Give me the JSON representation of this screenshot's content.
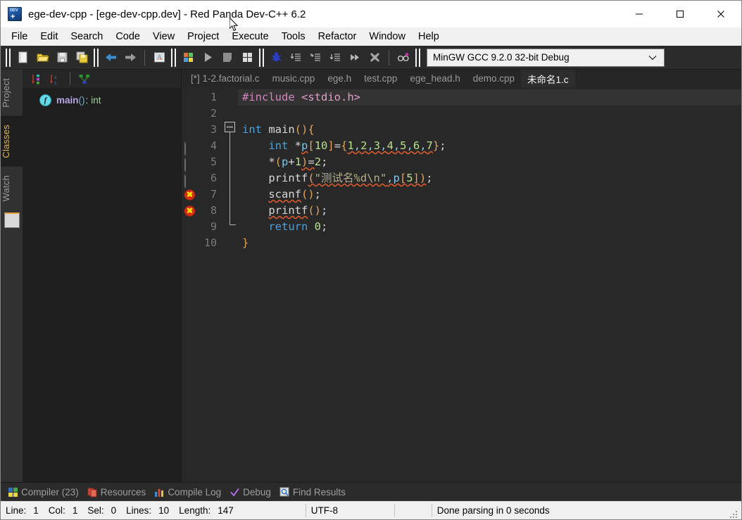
{
  "window": {
    "title": "ege-dev-cpp - [ege-dev-cpp.dev] - Red Panda Dev-C++ 6.2",
    "app_icon": "dev-cpp-icon",
    "minimize_label": "—",
    "maximize_label": "□",
    "close_label": "✕"
  },
  "menu": {
    "items": [
      {
        "label": "File"
      },
      {
        "label": "Edit"
      },
      {
        "label": "Search"
      },
      {
        "label": "Code"
      },
      {
        "label": "View"
      },
      {
        "label": "Project"
      },
      {
        "label": "Execute"
      },
      {
        "label": "Tools"
      },
      {
        "label": "Refactor"
      },
      {
        "label": "Window"
      },
      {
        "label": "Help"
      }
    ]
  },
  "toolbar": {
    "groups": [
      {
        "buttons": [
          {
            "name": "new-file-icon",
            "tip": "New"
          },
          {
            "name": "open-folder-icon",
            "tip": "Open"
          },
          {
            "name": "save-icon",
            "tip": "Save"
          },
          {
            "name": "save-all-icon",
            "tip": "Save All"
          }
        ]
      },
      {
        "buttons": [
          {
            "name": "back-arrow-icon",
            "tip": "Back"
          },
          {
            "name": "forward-arrow-icon",
            "tip": "Forward"
          },
          {
            "name": "format-code-icon",
            "tip": "Reformat Code"
          }
        ]
      },
      {
        "buttons": [
          {
            "name": "compile-icon",
            "tip": "Compile"
          },
          {
            "name": "run-icon",
            "tip": "Run"
          },
          {
            "name": "stop-execution-icon",
            "tip": "Stop Execution"
          },
          {
            "name": "compile-run-icon",
            "tip": "Compile & Run"
          }
        ]
      },
      {
        "buttons": [
          {
            "name": "debug-bug-icon",
            "tip": "Debug"
          },
          {
            "name": "step-over-icon",
            "tip": "Step Over"
          },
          {
            "name": "step-into-icon",
            "tip": "Step Into"
          },
          {
            "name": "step-out-icon",
            "tip": "Step Out"
          },
          {
            "name": "continue-icon",
            "tip": "Continue"
          },
          {
            "name": "stop-debug-icon",
            "tip": "Stop Debugger"
          }
        ]
      },
      {
        "buttons": [
          {
            "name": "add-watch-icon",
            "tip": "Add Watch"
          }
        ]
      }
    ],
    "compiler_set": {
      "value": "MinGW GCC 9.2.0 32-bit Debug",
      "caret": "⌄"
    }
  },
  "left_panel": {
    "vertical_tabs": [
      {
        "label": "Project",
        "active": false
      },
      {
        "label": "Classes",
        "active": true
      },
      {
        "label": "Watch",
        "active": false
      }
    ],
    "panel_toolbar": [
      {
        "name": "sort-by-type-icon"
      },
      {
        "name": "sort-alphabetical-icon"
      },
      {
        "name": "show-inherited-icon"
      }
    ],
    "class_browser": {
      "items": [
        {
          "icon": "function-icon",
          "name": "main",
          "parens": "()",
          "colon": ":",
          "return_type": "int"
        }
      ]
    }
  },
  "editor": {
    "tabs": [
      {
        "label": "[*] 1-2.factorial.c",
        "active": false
      },
      {
        "label": "music.cpp",
        "active": false
      },
      {
        "label": "ege.h",
        "active": false
      },
      {
        "label": "test.cpp",
        "active": false
      },
      {
        "label": "ege_head.h",
        "active": false
      },
      {
        "label": "demo.cpp",
        "active": false
      },
      {
        "label": "未命名1.c",
        "active": true
      }
    ],
    "gutter": [
      {
        "number": "1",
        "marker": "none"
      },
      {
        "number": "2",
        "marker": "none"
      },
      {
        "number": "3",
        "marker": "none"
      },
      {
        "number": "4",
        "marker": "breakpoint-gray"
      },
      {
        "number": "5",
        "marker": "breakpoint-gray"
      },
      {
        "number": "6",
        "marker": "breakpoint-gray"
      },
      {
        "number": "7",
        "marker": "error-red"
      },
      {
        "number": "8",
        "marker": "error-red"
      },
      {
        "number": "9",
        "marker": "none"
      },
      {
        "number": "10",
        "marker": "none"
      }
    ],
    "error_marker_glyph": "✖",
    "lines": [
      {
        "n": 1,
        "current": true,
        "text": "#include <stdio.h>"
      },
      {
        "n": 2,
        "current": false,
        "text": ""
      },
      {
        "n": 3,
        "current": false,
        "text": "int main(){"
      },
      {
        "n": 4,
        "current": false,
        "text": "    int *p[10]={1,2,3,4,5,6,7};"
      },
      {
        "n": 5,
        "current": false,
        "text": "    *(p+1)=2;"
      },
      {
        "n": 6,
        "current": false,
        "text": "    printf(\"测试名%d\\n\",p[5]);"
      },
      {
        "n": 7,
        "current": false,
        "text": "    scanf();"
      },
      {
        "n": 8,
        "current": false,
        "text": "    printf();"
      },
      {
        "n": 9,
        "current": false,
        "text": "    return 0;"
      },
      {
        "n": 10,
        "current": false,
        "text": "}"
      }
    ],
    "tokens": {
      "l1_include": "#include",
      "l1_header": "<stdio.h>",
      "l3_int": "int",
      "l3_main": "main",
      "l3_parens": "()",
      "l3_brace": "{",
      "l4_int": "int",
      "l4_star": "*",
      "l4_p": "p",
      "l4_lb": "[",
      "l4_10": "10",
      "l4_rb": "]",
      "l4_eq": "=",
      "l4_lbrace": "{",
      "l4_n1": "1",
      "l4_c1": ",",
      "l4_n2": "2",
      "l4_c2": ",",
      "l4_n3": "3",
      "l4_c3": ",",
      "l4_n4": "4",
      "l4_c4": ",",
      "l4_n5": "5",
      "l4_c5": ",",
      "l4_n6": "6",
      "l4_c6": ",",
      "l4_n7": "7",
      "l4_rbrace": "}",
      "l4_semi": ";",
      "l5_star": "*",
      "l5_lp": "(",
      "l5_p": "p",
      "l5_plus": "+",
      "l5_1": "1",
      "l5_rp": ")",
      "l5_eq": "=",
      "l5_2": "2",
      "l5_semi": ";",
      "l6_printf": "printf",
      "l6_lp": "(",
      "l6_str": "\"测试名%d\\n\"",
      "l6_comma": ",",
      "l6_p": "p",
      "l6_lb": "[",
      "l6_5": "5",
      "l6_rb": "]",
      "l6_rp": ")",
      "l6_semi": ";",
      "l7_scanf": "scanf",
      "l7_parens": "()",
      "l7_semi": ";",
      "l8_printf": "printf",
      "l8_parens": "()",
      "l8_semi": ";",
      "l9_return": "return",
      "l9_0": "0",
      "l9_semi": ";",
      "l10_rbrace": "}"
    }
  },
  "bottom_tabs": [
    {
      "label": "Compiler (23)",
      "icon": "compiler-icon"
    },
    {
      "label": "Resources",
      "icon": "resources-icon"
    },
    {
      "label": "Compile Log",
      "icon": "compile-log-icon"
    },
    {
      "label": "Debug",
      "icon": "debug-check-icon"
    },
    {
      "label": "Find Results",
      "icon": "find-results-icon"
    }
  ],
  "statusbar": {
    "line_label": "Line:",
    "line_value": "1",
    "col_label": "Col:",
    "col_value": "1",
    "sel_label": "Sel:",
    "sel_value": "0",
    "lines_label": "Lines:",
    "lines_value": "10",
    "length_label": "Length:",
    "length_value": "147",
    "encoding": "UTF-8",
    "message": "Done parsing in 0 seconds"
  },
  "colors": {
    "titlebar_bg": "#ffffff",
    "menubar_bg": "#f0f0f0",
    "toolbar_bg": "#2b2b2b",
    "editor_bg": "#282828",
    "current_line_bg": "#333333",
    "panel_bg": "#1e1e1e",
    "accent_active_tab": "#d8b35a",
    "error_red": "#d42a12",
    "error_glyph_yellow": "#ffe600"
  }
}
